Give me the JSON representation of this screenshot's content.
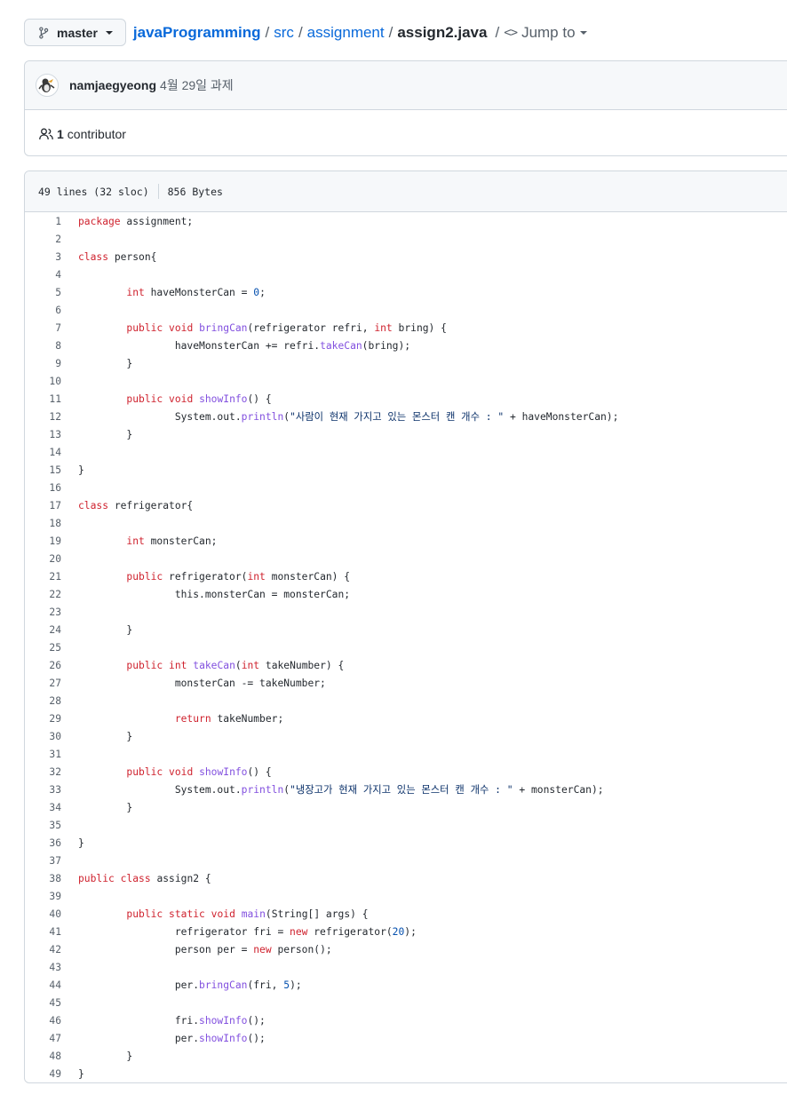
{
  "breadcrumb": {
    "branch": "master",
    "repo": "javaProgramming",
    "folder1": "src",
    "folder2": "assignment",
    "file": "assign2.java",
    "jump_label": "Jump to"
  },
  "commit": {
    "author": "namjaegyeong",
    "message": "4월 29일 과제"
  },
  "contributors": {
    "count": "1",
    "label": "contributor"
  },
  "file_info": {
    "lines": "49 lines (32 sloc)",
    "size": "856 Bytes"
  },
  "colors": {
    "keyword": "#cf222e",
    "function": "#8250df",
    "number": "#0550ae",
    "link": "#0969da"
  },
  "code_lines": [
    "package assignment;",
    "",
    "class person{",
    "",
    "        int haveMonsterCan = 0;",
    "",
    "        public void bringCan(refrigerator refri, int bring) {",
    "                haveMonsterCan += refri.takeCan(bring);",
    "        }",
    "",
    "        public void showInfo() {",
    "                System.out.println(\"사람이 현재 가지고 있는 몬스터 캔 개수 : \" + haveMonsterCan);",
    "        }",
    "",
    "}",
    "",
    "class refrigerator{",
    "",
    "        int monsterCan;",
    "",
    "        public refrigerator(int monsterCan) {",
    "                this.monsterCan = monsterCan;",
    "",
    "        }",
    "",
    "        public int takeCan(int takeNumber) {",
    "                monsterCan -= takeNumber;",
    "",
    "                return takeNumber;",
    "        }",
    "",
    "        public void showInfo() {",
    "                System.out.println(\"냉장고가 현재 가지고 있는 몬스터 캔 개수 : \" + monsterCan);",
    "        }",
    "",
    "}",
    "",
    "public class assign2 {",
    "",
    "        public static void main(String[] args) {",
    "                refrigerator fri = new refrigerator(20);",
    "                person per = new person();",
    "",
    "                per.bringCan(fri, 5);",
    "",
    "                fri.showInfo();",
    "                per.showInfo();",
    "        }",
    "}"
  ]
}
